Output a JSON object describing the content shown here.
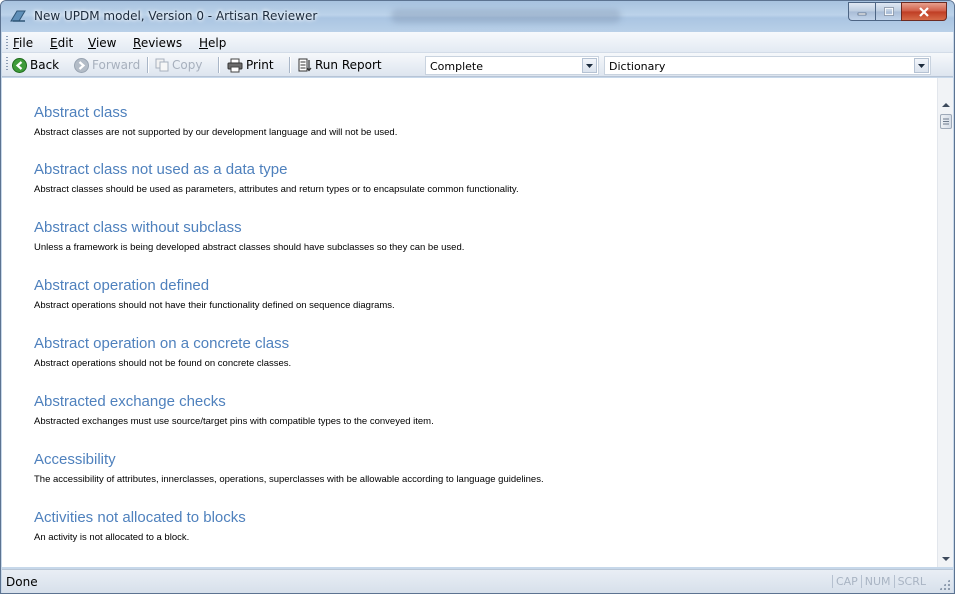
{
  "window": {
    "title": "New UPDM model, Version 0 - Artisan Reviewer"
  },
  "menu": {
    "items": [
      {
        "label": "File",
        "accel": "F",
        "rest": "ile"
      },
      {
        "label": "Edit",
        "accel": "E",
        "rest": "dit"
      },
      {
        "label": "View",
        "accel": "V",
        "rest": "iew"
      },
      {
        "label": "Reviews",
        "accel": "R",
        "rest": "eviews"
      },
      {
        "label": "Help",
        "accel": "H",
        "rest": "elp"
      }
    ]
  },
  "toolbar": {
    "back_label": "Back",
    "forward_label": "Forward",
    "copy_label": "Copy",
    "print_label": "Print",
    "run_report_label": "Run Report",
    "filter_value": "Complete",
    "report_value": "Dictionary"
  },
  "entries": [
    {
      "title": "Abstract class",
      "description": "Abstract classes are not supported by our development language and will not be used."
    },
    {
      "title": "Abstract class not used as a data type",
      "description": "Abstract classes should be used as parameters, attributes and return types or to encapsulate common functionality."
    },
    {
      "title": "Abstract class without subclass",
      "description": "Unless a framework is being developed abstract classes should have subclasses so they can be used."
    },
    {
      "title": "Abstract operation defined",
      "description": "Abstract operations should not have their functionality defined on sequence diagrams."
    },
    {
      "title": "Abstract operation on a concrete class",
      "description": "Abstract operations should not be found on concrete classes."
    },
    {
      "title": "Abstracted exchange checks",
      "description": "Abstracted exchanges must use source/target pins with compatible types to the conveyed item."
    },
    {
      "title": "Accessibility",
      "description": "The accessibility of attributes, innerclasses, operations, superclasses with be allowable according to language guidelines."
    },
    {
      "title": "Activities not allocated to blocks",
      "description": "An activity is not allocated to a block."
    }
  ],
  "status": {
    "text": "Done",
    "cap": "CAP",
    "num": "NUM",
    "scrl": "SCRL"
  },
  "colors": {
    "entry_title": "#4f81bd",
    "title_bar": "#b9d0e8"
  }
}
